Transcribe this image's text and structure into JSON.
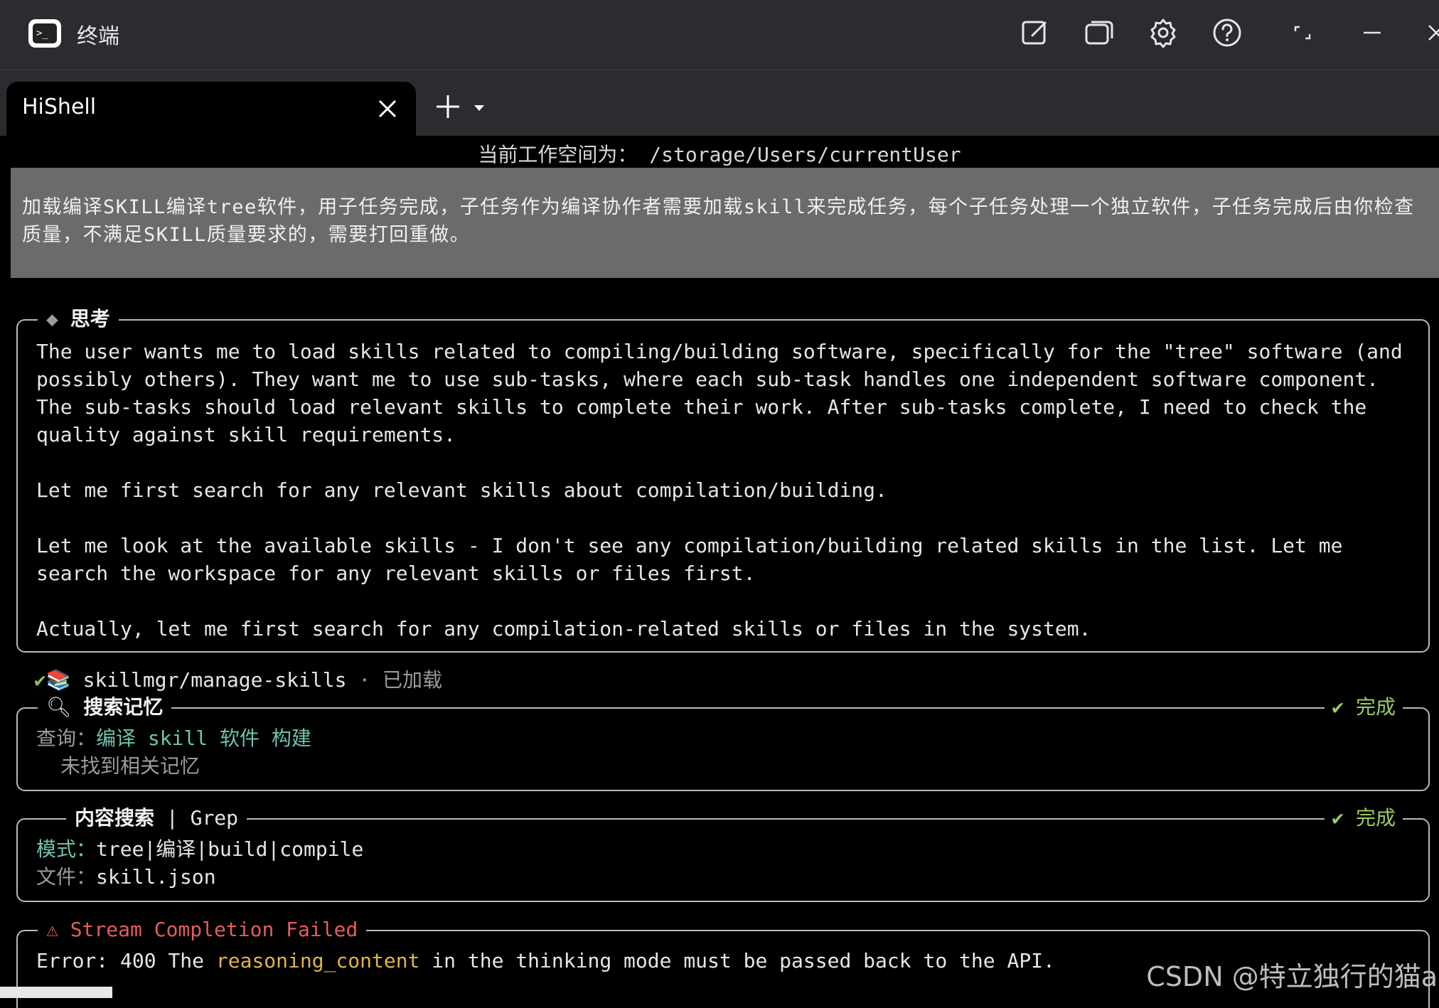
{
  "window": {
    "title": "终端",
    "app_icon_glyph": ">_"
  },
  "toolbar": {
    "icons": [
      "edit-icon",
      "window-icon",
      "gear-icon",
      "help-icon",
      "fullscreen-icon",
      "minimize-icon",
      "close-icon"
    ]
  },
  "tabs": [
    {
      "label": "HiShell",
      "active": true
    }
  ],
  "terminal": {
    "workspace_line": "当前工作空间为： /storage/Users/currentUser",
    "prompt": "加载编译SKILL编译tree软件，用子任务完成，子任务作为编译协作者需要加载skill来完成任务，每个子任务处理一个独立软件，子任务完成后由你检查质量，不满足SKILL质量要求的，需要打回重做。",
    "thinking": {
      "title": "思考",
      "lines": [
        "The user wants me to load skills related to compiling/building software, specifically for the \"tree\" software (and",
        "possibly others). They want me to use sub-tasks, where each sub-task handles one independent software component.",
        "The sub-tasks should load relevant skills to complete their work. After sub-tasks complete, I need to check the",
        "quality against skill requirements.",
        "",
        "Let me first search for any relevant skills about compilation/building.",
        "",
        "Let me look at the available skills - I don't see any compilation/building related skills in the list. Let me",
        "search the workspace for any relevant skills or files first.",
        "",
        "Actually, let me first search for any compilation-related skills or files in the system."
      ]
    },
    "skill_loaded": {
      "name": "skillmgr/manage-skills",
      "separator": "·",
      "status": "已加载"
    },
    "memory_search": {
      "title": "搜索记忆",
      "status": "完成",
      "query_label": "查询：",
      "query_value": "编译 skill 软件 构建",
      "result": "未找到相关记忆"
    },
    "content_search": {
      "title": "内容搜索",
      "tool": "| Grep",
      "status": "完成",
      "pattern_label": "模式：",
      "pattern_value": "tree|编译|build|compile",
      "file_label": "文件：",
      "file_value": "skill.json"
    },
    "error": {
      "title": "Stream Completion Failed",
      "prefix": "Error: 400 The ",
      "highlight": "reasoning_content",
      "suffix": " in the thinking mode must be passed back to the API."
    }
  },
  "watermark": "CSDN @特立独行的猫a",
  "colors": {
    "titlebar_bg": "#2a2c30",
    "terminal_bg": "#000000",
    "prompt_bg": "#6b6b6b",
    "success_green": "#9ccc65",
    "query_cyan": "#6fc3b2",
    "highlight_orange": "#e2b34a",
    "error_red": "#e35d5d"
  }
}
